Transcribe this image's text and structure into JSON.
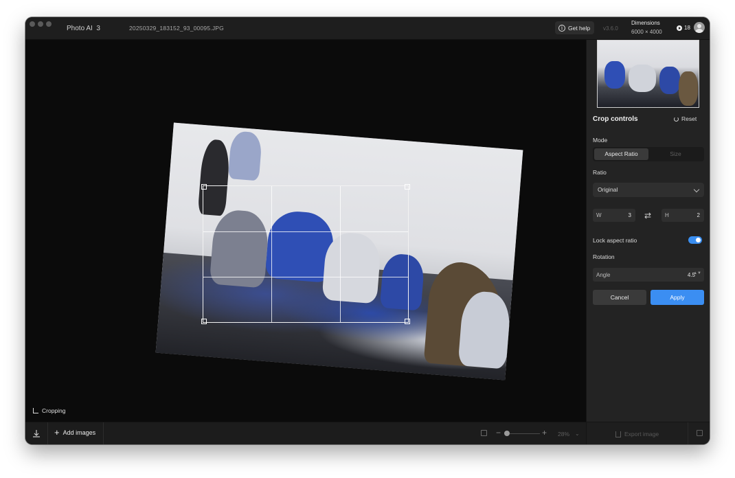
{
  "app": {
    "name": "Photo AI",
    "version_major": "3",
    "filename": "20250329_183152_93_00095.JPG"
  },
  "header": {
    "help_label": "Get help",
    "help_icon": "info-icon",
    "version": "v3.6.0",
    "dimensions_label": "Dimensions",
    "dimensions_value": "6000 × 4000",
    "credits": "18"
  },
  "canvas": {
    "mode_label": "Cropping",
    "rotation_degrees": 4.5
  },
  "bottombar": {
    "add_images_label": "Add images",
    "zoom_value": "28%"
  },
  "panel": {
    "title": "Crop controls",
    "reset_label": "Reset",
    "mode_label": "Mode",
    "mode_options": [
      "Aspect Ratio",
      "Size"
    ],
    "mode_selected": "Aspect Ratio",
    "ratio_label": "Ratio",
    "ratio_value": "Original",
    "width_label": "W",
    "width_value": "3",
    "height_label": "H",
    "height_value": "2",
    "lock_label": "Lock aspect ratio",
    "lock_enabled": true,
    "rotation_label": "Rotation",
    "angle_label": "Angle",
    "angle_value": "4.5",
    "cancel_label": "Cancel",
    "apply_label": "Apply",
    "export_label": "Export image"
  },
  "colors": {
    "accent": "#3b8ef2",
    "panel_bg": "#232323",
    "canvas_bg": "#0b0b0b"
  }
}
